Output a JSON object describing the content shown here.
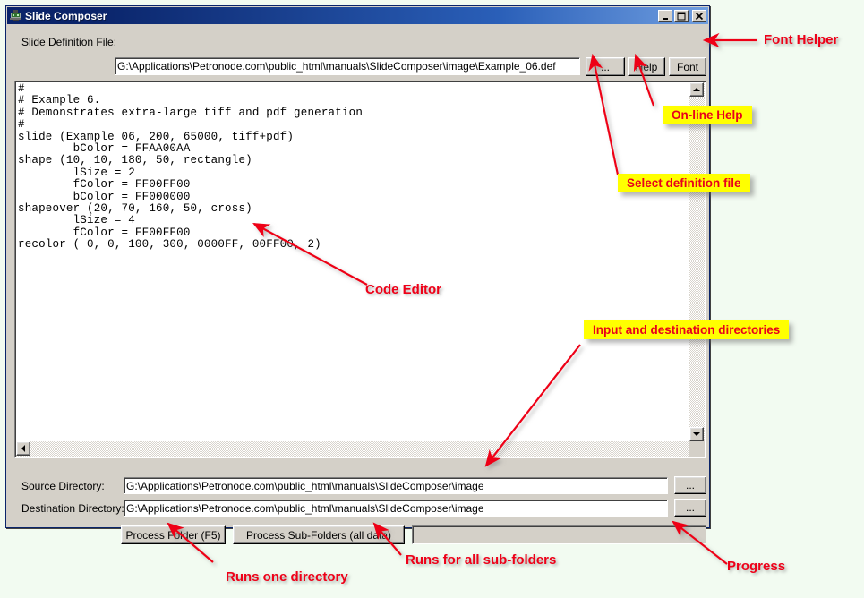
{
  "window": {
    "title": "Slide Composer",
    "icon": "app-icon",
    "controls": {
      "minimize": "_",
      "maximize": "❐",
      "close": "✕"
    }
  },
  "toolbar": {
    "slide_definition_label": "Slide Definition File:",
    "slide_definition_value": "G:\\Applications\\Petronode.com\\public_html\\manuals\\SlideComposer\\image\\Example_06.def",
    "browse_label": "...",
    "help_label": "Help",
    "font_label": "Font"
  },
  "editor": {
    "content": "#\n# Example 6.\n# Demonstrates extra-large tiff and pdf generation\n#\nslide (Example_06, 200, 65000, tiff+pdf)\n        bColor = FFAA00AA\nshape (10, 10, 180, 50, rectangle)\n        lSize = 2\n        fColor = FF00FF00\n        bColor = FF000000\nshapeover (20, 70, 160, 50, cross)\n        lSize = 4\n        fColor = FF00FF00\nrecolor ( 0, 0, 100, 300, 0000FF, 00FF00, 2)"
  },
  "directories": {
    "source_label": "Source Directory:",
    "source_value": "G:\\Applications\\Petronode.com\\public_html\\manuals\\SlideComposer\\image",
    "destination_label": "Destination Directory:",
    "destination_value": "G:\\Applications\\Petronode.com\\public_html\\manuals\\SlideComposer\\image",
    "browse_label": "..."
  },
  "actions": {
    "process_folder_label": "Process Folder (F5)",
    "process_subfolders_label": "Process Sub-Folders (all data)",
    "progress_value": ""
  },
  "annotations": {
    "font_helper": "Font Helper",
    "online_help": "On-line Help",
    "select_definition_file": "Select definition file",
    "code_editor": "Code Editor",
    "input_destination_directories": "Input and destination directories",
    "runs_one_directory": "Runs one directory",
    "runs_all_subfolders": "Runs for all sub-folders",
    "progress": "Progress"
  },
  "colors": {
    "page_background": "#f2fbf1",
    "window_face": "#d4d0c8",
    "titlebar_start": "#0a246a",
    "titlebar_end": "#6f9ee0",
    "callout_bg": "#ffff00",
    "annotation_red": "#ee0018"
  }
}
